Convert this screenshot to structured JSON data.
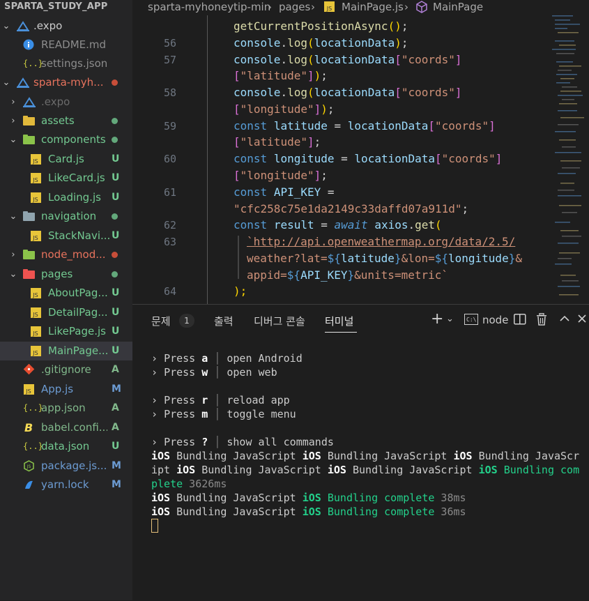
{
  "explorer": {
    "title": "SPARTA_STUDY_APP",
    "items": [
      {
        "label": ".expo",
        "status": ""
      },
      {
        "label": "README.md",
        "status": ""
      },
      {
        "label": "settings.json",
        "status": ""
      },
      {
        "label": "sparta-myh...",
        "status": ""
      },
      {
        "label": ".expo",
        "status": ""
      },
      {
        "label": "assets",
        "status": ""
      },
      {
        "label": "components",
        "status": ""
      },
      {
        "label": "Card.js",
        "status": "U"
      },
      {
        "label": "LikeCard.js",
        "status": "U"
      },
      {
        "label": "Loading.js",
        "status": "U"
      },
      {
        "label": "navigation",
        "status": ""
      },
      {
        "label": "StackNavi...",
        "status": "U"
      },
      {
        "label": "node_mod...",
        "status": ""
      },
      {
        "label": "pages",
        "status": ""
      },
      {
        "label": "AboutPag...",
        "status": "U"
      },
      {
        "label": "DetailPag...",
        "status": "U"
      },
      {
        "label": "LikePage.js",
        "status": "U"
      },
      {
        "label": "MainPage...",
        "status": "U"
      },
      {
        "label": ".gitignore",
        "status": "A"
      },
      {
        "label": "App.js",
        "status": "M"
      },
      {
        "label": "app.json",
        "status": "A"
      },
      {
        "label": "babel.confi...",
        "status": "A"
      },
      {
        "label": "data.json",
        "status": "U"
      },
      {
        "label": "package.js...",
        "status": "M"
      },
      {
        "label": "yarn.lock",
        "status": "M"
      }
    ]
  },
  "breadcrumb": {
    "folder": "sparta-myhoneytip-min",
    "subfolder": "pages",
    "file": "MainPage.js",
    "symbol": "MainPage"
  },
  "editor": {
    "line_numbers": [
      "56",
      "57",
      "58",
      "59",
      "60",
      "61",
      "62",
      "63",
      "64"
    ],
    "tokens": {
      "fn_getpos": "getCurrentPositionAsync",
      "paren_open_close": "()",
      "semi": ";",
      "console": "console",
      "dot": ".",
      "log": "log",
      "lparen": "(",
      "rparen": ")",
      "locationData": "locationData",
      "lbr": "[",
      "rbr": "]",
      "coords": "\"coords\"",
      "latitude_str": "\"latitude\"",
      "longitude_str": "\"longitude\"",
      "const": "const",
      "latitude": "latitude",
      "longitude": "longitude",
      "eq": " = ",
      "api_key": "API_KEY",
      "api_key_value": "\"cfc258c75e1da2149c33daffd07a911d\"",
      "result": "result",
      "await": "await",
      "axios": "axios",
      "get": "get",
      "url1": "`http://api.openweathermap.org/data/2.5/",
      "url2a": "weather?lat=",
      "tpl_open": "${",
      "tpl_close": "}",
      "url2b": "&lon=",
      "amp": "&",
      "url3a": "appid=",
      "url3b": "&units=metric",
      "backtick": "`",
      "close_stmt": ");"
    }
  },
  "panel": {
    "tabs": [
      "문제",
      "출력",
      "디버그 콘솔",
      "터미널"
    ],
    "problems_count": "1",
    "terminal_name": "node"
  },
  "terminal": {
    "prompt": "›",
    "press": "Press",
    "shortcuts": [
      {
        "key": "a",
        "action": "open Android"
      },
      {
        "key": "w",
        "action": "open web"
      },
      {
        "key": "r",
        "action": "reload app"
      },
      {
        "key": "m",
        "action": "toggle menu"
      },
      {
        "key": "?",
        "action": "show all commands"
      }
    ],
    "bundle_line1": [
      "iOS",
      " Bundling JavaScript ",
      "iOS",
      " Bundling JavaScript ",
      "iOS",
      " Bundling JavaScr"
    ],
    "bundle_line2": [
      "ipt ",
      "iOS",
      " Bundling JavaScript ",
      "iOS",
      " Bundling JavaScript ",
      "iOS",
      " Bundling com"
    ],
    "bundle_line3": [
      "plete",
      " 3626ms"
    ],
    "bundle_line4": [
      "iOS",
      " Bundling JavaScript ",
      "iOS",
      " Bundling complete",
      " 38ms"
    ],
    "bundle_line5": [
      "iOS",
      " Bundling JavaScript ",
      "iOS",
      " Bundling complete",
      " 36ms"
    ]
  },
  "colors": {
    "modified": "#e2c08d",
    "untracked": "#73c991",
    "added": "#81b88b",
    "deleted_dot": "#c74e39"
  }
}
